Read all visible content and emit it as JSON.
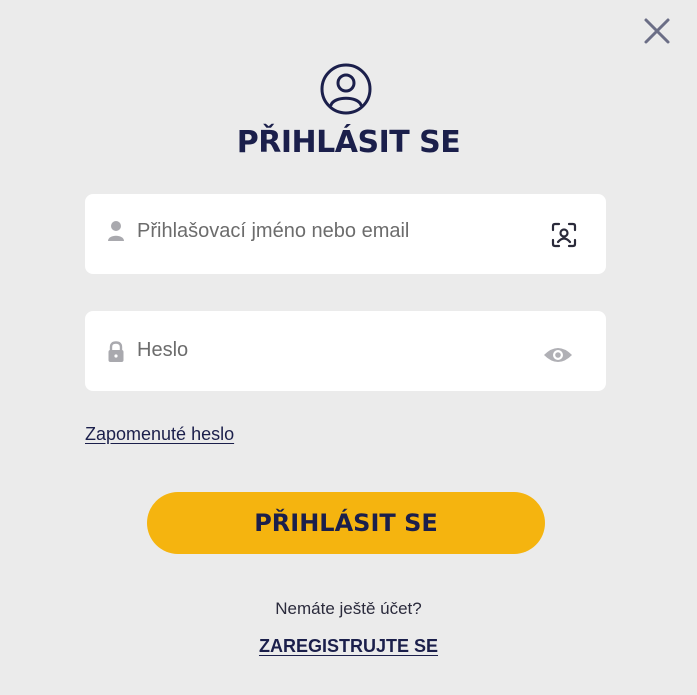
{
  "dialog": {
    "title": "PŘIHLÁSIT SE",
    "close_icon": "close-icon",
    "header_icon": "user-circle-icon"
  },
  "username": {
    "placeholder": "Přihlašovací jméno nebo email",
    "value": "",
    "lead_icon": "user-icon",
    "trail_icon": "face-scan-icon"
  },
  "password": {
    "placeholder": "Heslo",
    "value": "",
    "lead_icon": "lock-icon",
    "trail_icon": "eye-icon"
  },
  "forgot_password": "Zapomenuté heslo",
  "login_button": "PŘIHLÁSIT SE",
  "no_account_text": "Nemáte ještě účet?",
  "register_link": "ZAREGISTRUJTE SE",
  "colors": {
    "background": "#ebebeb",
    "primary_text": "#1b1f4b",
    "button": "#f5b40f",
    "field": "#ffffff"
  }
}
